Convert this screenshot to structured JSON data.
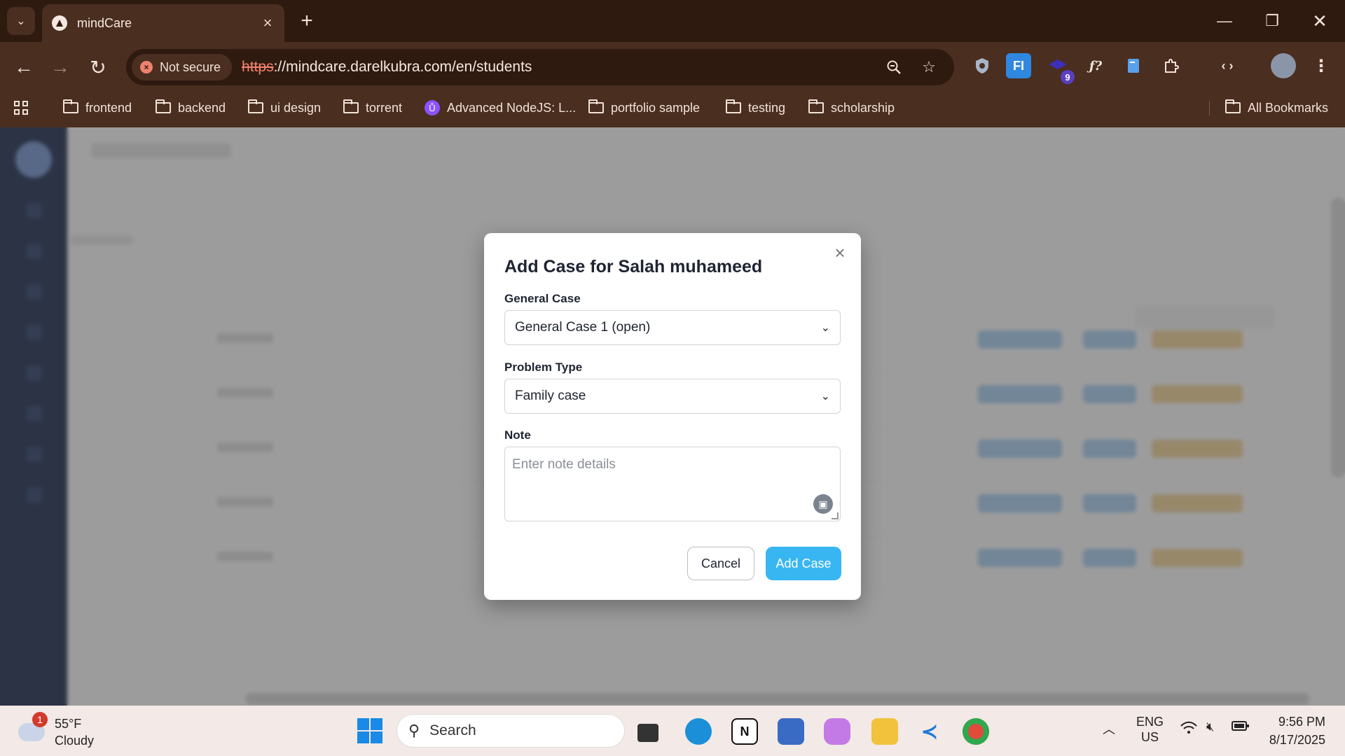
{
  "browser": {
    "tab_title": "mindCare",
    "security_label": "Not secure",
    "url_scheme": "https",
    "url_rest": "://mindcare.darelkubra.com/en/students",
    "extension_badge": "9",
    "bookmarks": [
      "frontend",
      "backend",
      "ui design",
      "torrent",
      "Advanced NodeJS: L...",
      "portfolio sample",
      "testing",
      "scholarship"
    ],
    "all_bookmarks": "All Bookmarks"
  },
  "modal": {
    "title": "Add Case for Salah muhameed",
    "general_case_label": "General Case",
    "general_case_value": "General Case 1 (open)",
    "problem_type_label": "Problem Type",
    "problem_type_value": "Family case",
    "note_label": "Note",
    "note_placeholder": "Enter note details",
    "cancel_label": "Cancel",
    "submit_label": "Add Case"
  },
  "taskbar": {
    "weather_temp": "55°F",
    "weather_desc": "Cloudy",
    "weather_badge": "1",
    "search_label": "Search",
    "lang_1": "ENG",
    "lang_2": "US",
    "time": "9:56 PM",
    "date": "8/17/2025"
  }
}
